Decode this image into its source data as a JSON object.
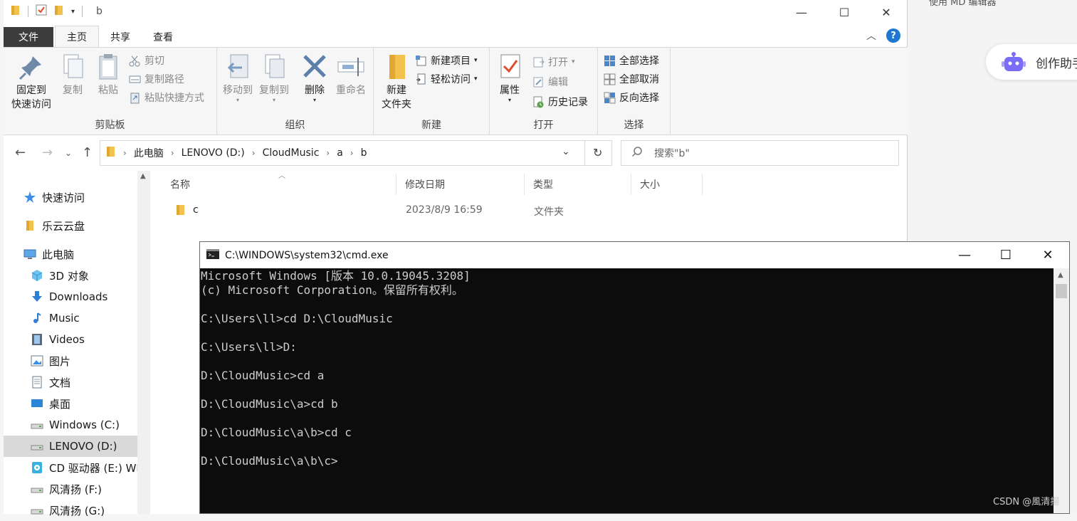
{
  "background_page": {
    "top_text": "使用 MD 编辑器",
    "assistant_label": "创作助手"
  },
  "explorer": {
    "title": "b",
    "window_controls": {
      "minimize": "—",
      "maximize": "☐",
      "close": "✕"
    },
    "menu_tabs": [
      "文件",
      "主页",
      "共享",
      "查看"
    ],
    "ribbon": {
      "clipboard": {
        "label": "剪贴板",
        "pin": "固定到\n快速访问",
        "pin_line1": "固定到",
        "pin_line2": "快速访问",
        "copy": "复制",
        "paste": "粘贴",
        "cut": "剪切",
        "copy_path": "复制路径",
        "paste_shortcut": "粘贴快捷方式"
      },
      "organize": {
        "label": "组织",
        "move_to": "移动到",
        "copy_to": "复制到",
        "delete": "删除",
        "rename": "重命名"
      },
      "new": {
        "label": "新建",
        "new_folder_line1": "新建",
        "new_folder_line2": "文件夹",
        "new_item": "新建项目",
        "easy_access": "轻松访问"
      },
      "open": {
        "label": "打开",
        "properties": "属性",
        "open": "打开",
        "edit": "编辑",
        "history": "历史记录"
      },
      "select": {
        "label": "选择",
        "select_all": "全部选择",
        "select_none": "全部取消",
        "invert": "反向选择"
      }
    },
    "address": {
      "crumbs": [
        "此电脑",
        "LENOVO (D:)",
        "CloudMusic",
        "a",
        "b"
      ],
      "search_placeholder": "搜索\"b\""
    },
    "nav_items": [
      {
        "label": "快速访问",
        "icon": "star-icon"
      },
      {
        "label": "乐云云盘",
        "icon": "folder-icon"
      },
      {
        "label": "此电脑",
        "icon": "computer-icon"
      },
      {
        "label": "3D 对象",
        "icon": "cube-icon"
      },
      {
        "label": "Downloads",
        "icon": "download-icon"
      },
      {
        "label": "Music",
        "icon": "music-icon"
      },
      {
        "label": "Videos",
        "icon": "video-icon"
      },
      {
        "label": "图片",
        "icon": "picture-icon"
      },
      {
        "label": "文档",
        "icon": "document-icon"
      },
      {
        "label": "桌面",
        "icon": "desktop-icon"
      },
      {
        "label": "Windows (C:)",
        "icon": "drive-icon"
      },
      {
        "label": "LENOVO (D:)",
        "icon": "drive-icon",
        "selected": true
      },
      {
        "label": "CD 驱动器 (E:) WD",
        "icon": "cd-drive-icon"
      },
      {
        "label": "风清扬 (F:)",
        "icon": "drive-icon"
      },
      {
        "label": "风清扬 (G:)",
        "icon": "drive-icon"
      }
    ],
    "columns": [
      "名称",
      "修改日期",
      "类型",
      "大小"
    ],
    "files": [
      {
        "name": "c",
        "date": "2023/8/9 16:59",
        "type": "文件夹",
        "size": ""
      }
    ]
  },
  "cmd": {
    "title": "C:\\WINDOWS\\system32\\cmd.exe",
    "lines": [
      "Microsoft Windows [版本 10.0.19045.3208]",
      "(c) Microsoft Corporation。保留所有权利。",
      "",
      "C:\\Users\\ll>cd D:\\CloudMusic",
      "",
      "C:\\Users\\ll>D:",
      "",
      "D:\\CloudMusic>cd a",
      "",
      "D:\\CloudMusic\\a>cd b",
      "",
      "D:\\CloudMusic\\a\\b>cd c",
      "",
      "D:\\CloudMusic\\a\\b\\c>"
    ]
  },
  "watermark": "CSDN @風清揚",
  "colors": {
    "accent_blue": "#1e78d0",
    "folder_yellow": "#f2c14e",
    "console_bg": "#0c0c0c",
    "console_text": "#cccccc",
    "file_tab": "#3c3c3c"
  }
}
